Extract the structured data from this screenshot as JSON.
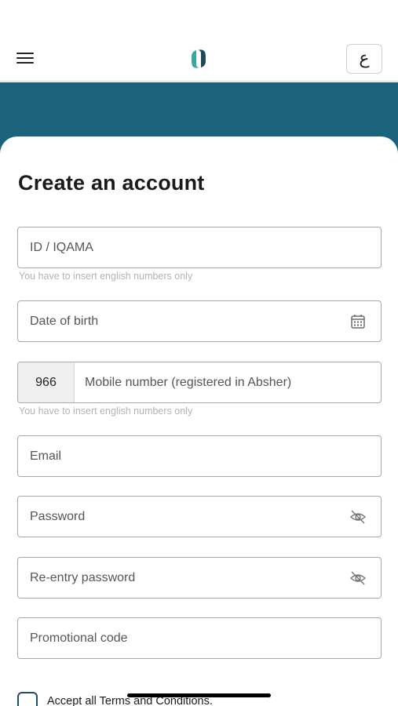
{
  "header": {
    "language_toggle": "ع"
  },
  "main": {
    "title": "Create an account",
    "fields": {
      "id_iqama": {
        "placeholder": "ID / IQAMA",
        "helper": "You have to insert english numbers only"
      },
      "dob": {
        "placeholder": "Date of birth"
      },
      "mobile": {
        "prefix": "966",
        "placeholder": "Mobile number (registered in Absher)",
        "helper": "You have to insert english numbers only"
      },
      "email": {
        "placeholder": "Email"
      },
      "password": {
        "placeholder": "Password"
      },
      "password_confirm": {
        "placeholder": "Re-entry password"
      },
      "promo": {
        "placeholder": "Promotional code"
      }
    },
    "terms_label": "Accept all Terms and Conditions."
  },
  "colors": {
    "banner": "#1b627c",
    "logo_dark": "#1f4a5c",
    "logo_teal": "#3aa7a0",
    "status_indicator": "#f2d21a"
  }
}
